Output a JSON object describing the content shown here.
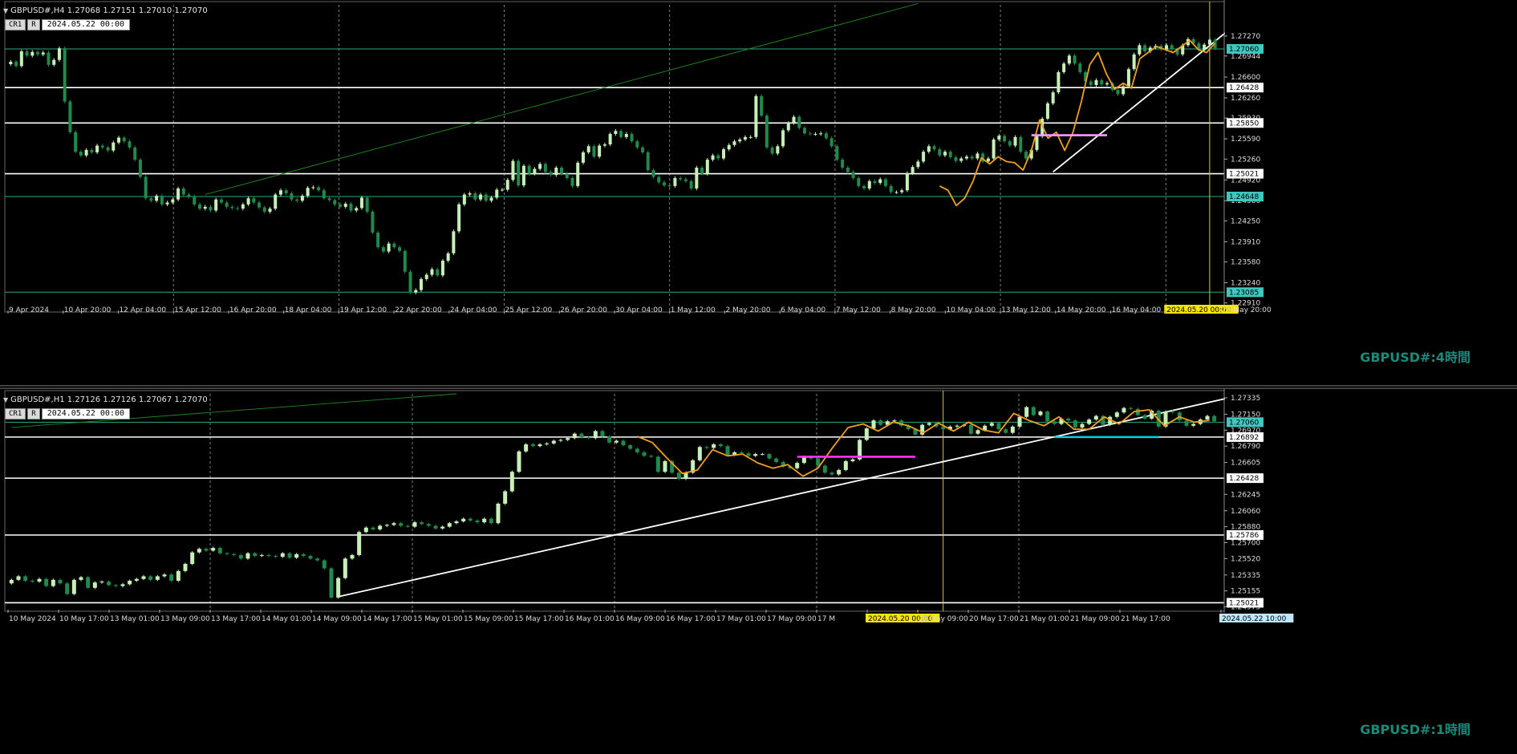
{
  "colors": {
    "bull": "#c6f0b8",
    "bear": "#1f8a4c",
    "grid": "#9a9a9a",
    "hline_white": "#ffffff",
    "hline_teal": "#2ea882",
    "ma": "#f0a020",
    "trend": "#ffffff",
    "channel": "#1e8c1e",
    "magenta": "#ff33ff",
    "pink": "#ff99ff",
    "cyan": "#00d2e6",
    "vline": "#d4c848",
    "price_tag_bg": "#40c8c0",
    "axis_text": "#dddddd"
  },
  "chart_data": [
    {
      "type": "candlestick",
      "symbol_header": "GBPUSD#,H4  1.27068 1.27151 1.27010 1.27070",
      "tool_labels": [
        "CR1",
        "R"
      ],
      "date_box": "2024.05.22 00:00",
      "watermark": "GBPUSD#:4時間",
      "ylim": [
        1.2284,
        1.2778
      ],
      "y_ticks": [
        1.2727,
        1.26944,
        1.266,
        1.2626,
        1.2593,
        1.2559,
        1.2526,
        1.2492,
        1.2458,
        1.2425,
        1.2391,
        1.2358,
        1.2324,
        1.2291
      ],
      "y_tick_labels": [
        "1.27270",
        "1.26944",
        "1.26600",
        "1.26260",
        "1.25930",
        "1.25590",
        "1.25260",
        "1.24920",
        "1.24580",
        "1.24250",
        "1.23910",
        "1.23580",
        "1.23240",
        "1.22910"
      ],
      "x_tick_labels": [
        "9 Apr 2024",
        "10 Apr 20:00",
        "12 Apr 04:00",
        "15 Apr 12:00",
        "16 Apr 20:00",
        "18 Apr 04:00",
        "19 Apr 12:00",
        "22 Apr 20:00",
        "24 Apr 04:00",
        "25 Apr 12:00",
        "26 Apr 20:00",
        "30 Apr 04:00",
        "1 May 12:00",
        "2 May 20:00",
        "6 May 04:00",
        "7 May 12:00",
        "8 May 20:00",
        "10 May 04:00",
        "13 May 12:00",
        "14 May 20:00",
        "16 May 04:00",
        "2024.05.20 00:00",
        "20 May 20:00"
      ],
      "x_tick_highlight": 21,
      "levels": [
        {
          "value": 1.2706,
          "label": "1.27060",
          "style": "teal",
          "tag": "cyan"
        },
        {
          "value": 1.26428,
          "label": "1.26428",
          "style": "white",
          "tag": "white"
        },
        {
          "value": 1.2585,
          "label": "1.25850",
          "style": "white",
          "tag": "white"
        },
        {
          "value": 1.25021,
          "label": "1.25021",
          "style": "white",
          "tag": "white"
        },
        {
          "value": 1.24648,
          "label": "1.24648",
          "style": "teal",
          "tag": "cyan"
        },
        {
          "value": 1.23085,
          "label": "1.23085",
          "style": "teal",
          "tag": "cyan"
        }
      ],
      "close": [
        1.2685,
        1.2678,
        1.2702,
        1.2695,
        1.2701,
        1.2697,
        1.27,
        1.268,
        1.2688,
        1.2707,
        1.262,
        1.257,
        1.2538,
        1.2532,
        1.2541,
        1.2537,
        1.2548,
        1.2545,
        1.254,
        1.2553,
        1.2561,
        1.2555,
        1.2545,
        1.2525,
        1.2497,
        1.2462,
        1.2458,
        1.2466,
        1.2452,
        1.2455,
        1.246,
        1.2478,
        1.2468,
        1.2465,
        1.2452,
        1.2445,
        1.2448,
        1.2442,
        1.246,
        1.2455,
        1.2448,
        1.2446,
        1.2445,
        1.2452,
        1.2462,
        1.2455,
        1.2447,
        1.244,
        1.2445,
        1.2468,
        1.2475,
        1.247,
        1.246,
        1.2458,
        1.2466,
        1.2479,
        1.248,
        1.2475,
        1.2462,
        1.2459,
        1.2452,
        1.2448,
        1.2453,
        1.2442,
        1.2446,
        1.2463,
        1.244,
        1.2406,
        1.2382,
        1.2375,
        1.2388,
        1.2382,
        1.2376,
        1.2342,
        1.2308,
        1.2312,
        1.233,
        1.2337,
        1.2346,
        1.2336,
        1.236,
        1.2372,
        1.2408,
        1.2452,
        1.2468,
        1.247,
        1.246,
        1.2468,
        1.2458,
        1.2463,
        1.2476,
        1.2476,
        1.2492,
        1.2523,
        1.2483,
        1.2515,
        1.2502,
        1.251,
        1.2518,
        1.2505,
        1.25,
        1.2512,
        1.2502,
        1.2495,
        1.2482,
        1.252,
        1.2537,
        1.2547,
        1.253,
        1.2548,
        1.255,
        1.2567,
        1.2572,
        1.2562,
        1.2567,
        1.2555,
        1.2545,
        1.2537,
        1.2508,
        1.2497,
        1.2488,
        1.2483,
        1.2482,
        1.2495,
        1.2493,
        1.249,
        1.2478,
        1.2512,
        1.2502,
        1.2525,
        1.2532,
        1.2527,
        1.2542,
        1.2549,
        1.2555,
        1.2558,
        1.2562,
        1.2562,
        1.2629,
        1.2597,
        1.2545,
        1.2535,
        1.2547,
        1.2573,
        1.2585,
        1.2595,
        1.2577,
        1.2568,
        1.2567,
        1.2567,
        1.2568,
        1.256,
        1.2547,
        1.2525,
        1.2512,
        1.2505,
        1.2495,
        1.2482,
        1.2478,
        1.249,
        1.2487,
        1.2493,
        1.2482,
        1.2472,
        1.2472,
        1.2475,
        1.2503,
        1.2513,
        1.2522,
        1.2538,
        1.2547,
        1.2542,
        1.2532,
        1.2538,
        1.2529,
        1.2523,
        1.2527,
        1.253,
        1.2527,
        1.2535,
        1.2522,
        1.2527,
        1.2558,
        1.2564,
        1.2555,
        1.2548,
        1.2562,
        1.2538,
        1.2527,
        1.2541,
        1.2563,
        1.2592,
        1.2617,
        1.2635,
        1.2668,
        1.2682,
        1.2695,
        1.2682,
        1.2668,
        1.2653,
        1.2647,
        1.2655,
        1.2648,
        1.265,
        1.2639,
        1.2632,
        1.2645,
        1.2673,
        1.2697,
        1.2712,
        1.2702,
        1.2708,
        1.2711,
        1.2705,
        1.2712,
        1.2705,
        1.2697,
        1.2712,
        1.2722,
        1.2715,
        1.2704,
        1.2713,
        1.2721,
        1.2707
      ],
      "ma": [
        [
          1.2482,
          1.2475,
          1.245,
          1.2462,
          1.249,
          1.2528,
          1.2518,
          1.253,
          1.2522,
          1.252,
          1.2508,
          1.254,
          1.259,
          1.256,
          1.257,
          1.254,
          1.257,
          1.262,
          1.268,
          1.27,
          1.2665,
          1.264,
          1.265,
          1.2642,
          1.269,
          1.27,
          1.271,
          1.2705,
          1.27,
          1.271,
          1.272,
          1.2705,
          1.27,
          1.2715
        ]
      ],
      "ma_start_index": 172,
      "trendlines": [
        {
          "x1": 193,
          "y1": 1.2505,
          "x2": 226,
          "y2": 1.274,
          "color": "trend"
        },
        {
          "x1": 36,
          "y1": 1.2468,
          "x2": 168,
          "y2": 1.278,
          "color": "channel"
        }
      ],
      "segments": [
        {
          "x1": 189,
          "y1": 1.2565,
          "x2": 203,
          "y2": 1.2565,
          "color": "pink"
        },
        {
          "x1": 227,
          "y1": 1.2683,
          "x2": 233,
          "y2": 1.2683,
          "color": "cyan"
        }
      ],
      "vlines": [
        {
          "index": 222
        }
      ]
    },
    {
      "type": "candlestick",
      "symbol_header": "GBPUSD#,H1  1.27126 1.27126 1.27067 1.27070",
      "tool_labels": [
        "CR1",
        "R"
      ],
      "date_box": "2024.05.22 00:00",
      "watermark": "GBPUSD#:1時間",
      "ylim": [
        1.2498,
        1.2738
      ],
      "y_ticks": [
        1.27335,
        1.2715,
        1.2697,
        1.2679,
        1.26605,
        1.26245,
        1.2606,
        1.2588,
        1.257,
        1.2552,
        1.25335,
        1.25155,
        1.24975
      ],
      "y_tick_labels": [
        "1.27335",
        "1.27150",
        "1.26970",
        "1.26790",
        "1.26605",
        "1.26245",
        "1.26060",
        "1.25880",
        "1.25700",
        "1.25520",
        "1.25335",
        "1.25155",
        "1.24975"
      ],
      "x_tick_labels": [
        "10 May 2024",
        "10 May 17:00",
        "13 May 01:00",
        "13 May 09:00",
        "13 May 17:00",
        "14 May 01:00",
        "14 May 09:00",
        "14 May 17:00",
        "15 May 01:00",
        "15 May 09:00",
        "15 May 17:00",
        "16 May 01:00",
        "16 May 09:00",
        "16 May 17:00",
        "17 May 01:00",
        "17 May 09:00",
        "17 M",
        "2024.05.20 00:00",
        "20 May 09:00",
        "20 May 17:00",
        "21 May 01:00",
        "21 May 09:00",
        "21 May 17:00",
        "",
        "2024.05.22 10:00"
      ],
      "x_tick_highlight": 17,
      "x_tick_cursor": 24,
      "levels": [
        {
          "value": 1.2706,
          "label": "1.27060",
          "style": "teal",
          "tag": "cyan"
        },
        {
          "value": 1.26892,
          "label": "1.26892",
          "style": "white",
          "tag": "white"
        },
        {
          "value": 1.26428,
          "label": "1.26428",
          "style": "white",
          "tag": "white"
        },
        {
          "value": 1.25786,
          "label": "1.25786",
          "style": "white",
          "tag": "white"
        },
        {
          "value": 1.25021,
          "label": "1.25021",
          "style": "white",
          "tag": "white"
        }
      ],
      "close": [
        1.2528,
        1.2532,
        1.2527,
        1.2526,
        1.2529,
        1.2521,
        1.2528,
        1.2524,
        1.2512,
        1.2528,
        1.2531,
        1.2519,
        1.2525,
        1.2526,
        1.2522,
        1.2521,
        1.2523,
        1.2527,
        1.2529,
        1.2532,
        1.2528,
        1.2532,
        1.2534,
        1.2527,
        1.2538,
        1.2546,
        1.2559,
        1.2563,
        1.2561,
        1.2564,
        1.2558,
        1.2557,
        1.2556,
        1.2552,
        1.2558,
        1.2555,
        1.2556,
        1.2555,
        1.2554,
        1.2558,
        1.2553,
        1.2557,
        1.2555,
        1.2552,
        1.255,
        1.2541,
        1.2508,
        1.253,
        1.2552,
        1.2556,
        1.2582,
        1.2587,
        1.2585,
        1.2589,
        1.259,
        1.2592,
        1.2589,
        1.2588,
        1.2593,
        1.2591,
        1.2589,
        1.2586,
        1.2588,
        1.2592,
        1.2594,
        1.2597,
        1.2595,
        1.2593,
        1.2597,
        1.2592,
        1.2614,
        1.2628,
        1.265,
        1.2673,
        1.2681,
        1.2679,
        1.2681,
        1.2682,
        1.2685,
        1.2686,
        1.2688,
        1.2693,
        1.2689,
        1.2688,
        1.2696,
        1.269,
        1.2683,
        1.2685,
        1.268,
        1.2676,
        1.2672,
        1.2668,
        1.2667,
        1.265,
        1.2662,
        1.2649,
        1.2642,
        1.2649,
        1.2663,
        1.2678,
        1.2677,
        1.2681,
        1.2679,
        1.2669,
        1.2672,
        1.2671,
        1.2668,
        1.267,
        1.267,
        1.2665,
        1.2661,
        1.2656,
        1.2654,
        1.266,
        1.2667,
        1.2665,
        1.2657,
        1.2649,
        1.2647,
        1.2652,
        1.2662,
        1.2664,
        1.2686,
        1.2699,
        1.2708,
        1.2703,
        1.2707,
        1.2708,
        1.2702,
        1.2698,
        1.2692,
        1.2703,
        1.2705,
        1.2701,
        1.2698,
        1.2701,
        1.2702,
        1.2703,
        1.2693,
        1.2697,
        1.2702,
        1.2705,
        1.2698,
        1.2694,
        1.2701,
        1.2712,
        1.2723,
        1.2714,
        1.2718,
        1.2707,
        1.2704,
        1.271,
        1.2708,
        1.27,
        1.2704,
        1.2709,
        1.2713,
        1.2703,
        1.2712,
        1.2717,
        1.2722,
        1.2721,
        1.2714,
        1.271,
        1.2719,
        1.2701,
        1.2718,
        1.2717,
        1.2708,
        1.2702,
        1.2704,
        1.2709,
        1.2713,
        1.2707
      ],
      "ma": [
        [
          1.269,
          1.2683,
          1.2665,
          1.2648,
          1.2652,
          1.2675,
          1.2668,
          1.267,
          1.266,
          1.2654,
          1.2658,
          1.2645,
          1.2654,
          1.2678,
          1.27,
          1.2704,
          1.2696,
          1.2706,
          1.2702,
          1.2694,
          1.2705,
          1.2696,
          1.2706,
          1.2697,
          1.2694,
          1.2716,
          1.2708,
          1.2702,
          1.2712,
          1.2698,
          1.2698,
          1.2712,
          1.2704,
          1.2718,
          1.272,
          1.2702,
          1.2712,
          1.2706,
          1.2708
        ]
      ],
      "ma_start_index": 90,
      "trendlines": [
        {
          "x1": 47,
          "y1": 1.2509,
          "x2": 176,
          "y2": 1.2735,
          "color": "trend"
        },
        {
          "x1": 0,
          "y1": 1.27,
          "x2": 64,
          "y2": 1.2738,
          "color": "channel"
        }
      ],
      "segments": [
        {
          "x1": 113,
          "y1": 1.2667,
          "x2": 130,
          "y2": 1.2667,
          "color": "magenta"
        },
        {
          "x1": 150,
          "y1": 1.26892,
          "x2": 165,
          "y2": 1.26892,
          "color": "cyan"
        }
      ],
      "vlines": [
        {
          "index": 134
        }
      ]
    }
  ]
}
